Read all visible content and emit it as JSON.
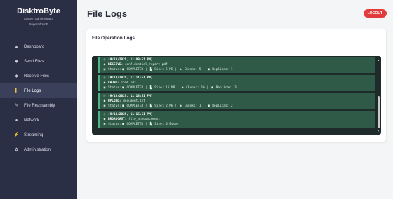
{
  "brand": {
    "title": "DisktroByte",
    "subtitle": "System Administrator",
    "user": "SuperadminE"
  },
  "sidebar": {
    "items": [
      {
        "label": "Dashboard",
        "icon": "dashboard-icon",
        "glyph": "▲"
      },
      {
        "label": "Send Files",
        "icon": "send-icon",
        "glyph": "◆"
      },
      {
        "label": "Receive Files",
        "icon": "receive-icon",
        "glyph": "◆"
      },
      {
        "label": "File Logs",
        "icon": "logs-icon",
        "glyph": "▌",
        "active": true
      },
      {
        "label": "File Reassembly",
        "icon": "wrench-icon",
        "glyph": "✎"
      },
      {
        "label": "Network",
        "icon": "network-icon",
        "glyph": "●"
      },
      {
        "label": "Streaming",
        "icon": "streaming-icon",
        "glyph": "⚡"
      },
      {
        "label": "Administration",
        "icon": "gear-icon",
        "glyph": "✿"
      }
    ]
  },
  "header": {
    "title": "File Logs",
    "logout_label": "LOGOUT"
  },
  "card": {
    "title": "File Operation Logs"
  },
  "logs": [
    {
      "time": "[9/18/2025, 11:09:51 PM]",
      "action_label": "RECEIVE:",
      "file": "confidential_report.pdf",
      "status_label": "Status:",
      "status": "COMPLETED",
      "size_label": "Size:",
      "size": "5 MB",
      "chunks_label": "Chunks:",
      "chunks": "5",
      "replicas_label": "Replicas:",
      "replicas": "1"
    },
    {
      "time": "[9/18/2025, 11:11:51 PM]",
      "action_label": "CHUNK:",
      "file": "15mb.pdf",
      "status_label": "Status:",
      "status": "COMPLETED",
      "size_label": "Size:",
      "size": "15 MB",
      "chunks_label": "Chunks:",
      "chunks": "16",
      "replicas_label": "Replicas:",
      "replicas": "3"
    },
    {
      "time": "[9/18/2025, 11:13:51 PM]",
      "action_label": "UPLOAD:",
      "file": "document.txt",
      "status_label": "Status:",
      "status": "COMPLETED",
      "size_label": "Size:",
      "size": "2 MB",
      "chunks_label": "Chunks:",
      "chunks": "1",
      "replicas_label": "Replicas:",
      "replicas": "2"
    },
    {
      "time": "[9/18/2025, 11:15:51 PM]",
      "action_label": "BROADCAST:",
      "file": "file_announcement",
      "status_label": "Status:",
      "status": "COMPLETED",
      "size_label": "Size:",
      "size": "0 Bytes"
    }
  ],
  "colors": {
    "sidebar_bg": "#2b2f45",
    "log_bg": "#1f2b2b",
    "entry_bg": "#2f5a47",
    "logout": "#e23b3b"
  }
}
